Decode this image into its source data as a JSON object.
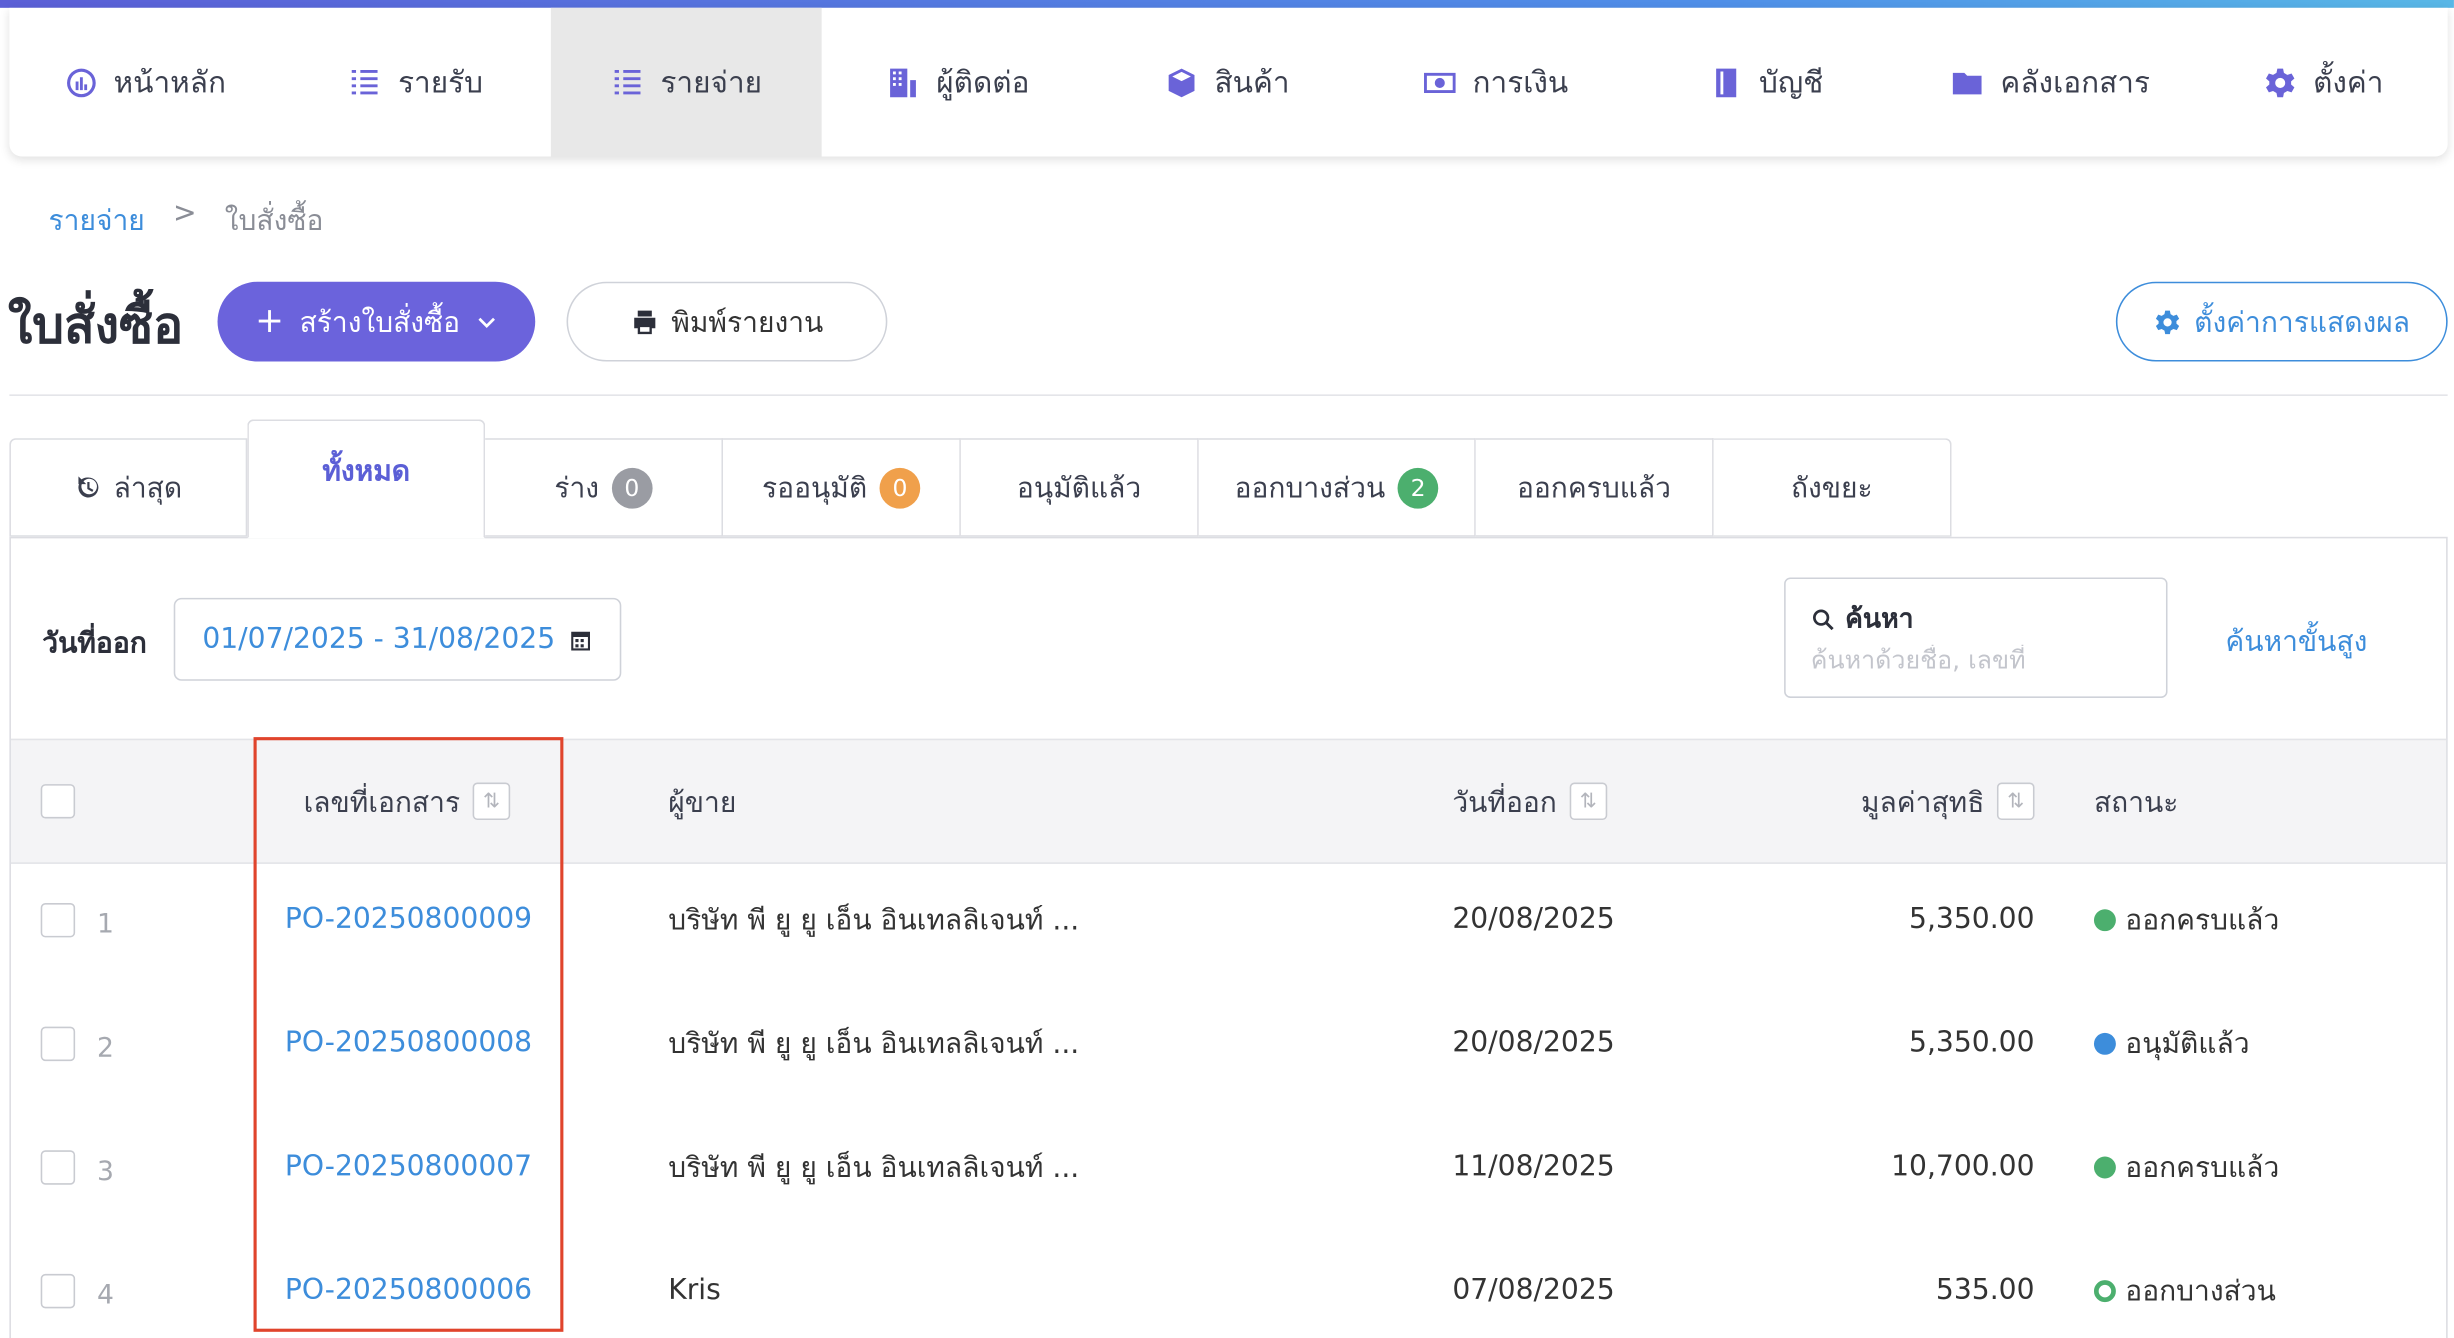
{
  "nav": {
    "items": [
      {
        "label": "หน้าหลัก",
        "icon": "dashboard-icon"
      },
      {
        "label": "รายรับ",
        "icon": "income-list-icon"
      },
      {
        "label": "รายจ่าย",
        "icon": "expense-list-icon",
        "active": true
      },
      {
        "label": "ผู้ติดต่อ",
        "icon": "contacts-building-icon"
      },
      {
        "label": "สินค้า",
        "icon": "product-box-icon"
      },
      {
        "label": "การเงิน",
        "icon": "money-icon"
      },
      {
        "label": "บัญชี",
        "icon": "ledger-book-icon"
      },
      {
        "label": "คลังเอกสาร",
        "icon": "folder-icon"
      },
      {
        "label": "ตั้งค่า",
        "icon": "gear-icon"
      }
    ]
  },
  "breadcrumb": {
    "parent": "รายจ่าย",
    "separator": ">",
    "current": "ใบสั่งซื้อ"
  },
  "header": {
    "title": "ใบสั่งซื้อ",
    "create_label": "สร้างใบสั่งซื้อ",
    "print_label": "พิมพ์รายงาน",
    "display_settings_label": "ตั้งค่าการแสดงผล"
  },
  "tabs": [
    {
      "label": "ล่าสุด",
      "icon": "history-icon"
    },
    {
      "label": "ทั้งหมด",
      "active": true
    },
    {
      "label": "ร่าง",
      "count": "0",
      "badge_color": "#9a9ca3"
    },
    {
      "label": "รออนุมัติ",
      "count": "0",
      "badge_color": "#f0a04b"
    },
    {
      "label": "อนุมัติแล้ว"
    },
    {
      "label": "ออกบางส่วน",
      "count": "2",
      "badge_color": "#4caf6e"
    },
    {
      "label": "ออกครบแล้ว"
    },
    {
      "label": "ถังขยะ"
    }
  ],
  "filters": {
    "date_label": "วันที่ออก",
    "date_range": "01/07/2025 - 31/08/2025",
    "search_label": "ค้นหา",
    "search_placeholder": "ค้นหาด้วยชื่อ, เลขที่",
    "search_value": "",
    "advanced_search_label": "ค้นหาขั้นสูง"
  },
  "table": {
    "columns": {
      "doc_no": "เลขที่เอกสาร",
      "vendor": "ผู้ขาย",
      "issue_date": "วันที่ออก",
      "net_value": "มูลค่าสุทธิ",
      "status": "สถานะ"
    },
    "rows": [
      {
        "num": "1",
        "doc_no": "PO-20250800009",
        "vendor": "บริษัท พี ยู ยู เอ็น อินเทลลิเจนท์ ...",
        "issue_date": "20/08/2025",
        "net_value": "5,350.00",
        "status": "ออกครบแล้ว",
        "status_color": "#4caf6e",
        "status_style": "filled"
      },
      {
        "num": "2",
        "doc_no": "PO-20250800008",
        "vendor": "บริษัท พี ยู ยู เอ็น อินเทลลิเจนท์ ...",
        "issue_date": "20/08/2025",
        "net_value": "5,350.00",
        "status": "อนุมัติแล้ว",
        "status_color": "#3d8ddb",
        "status_style": "filled"
      },
      {
        "num": "3",
        "doc_no": "PO-20250800007",
        "vendor": "บริษัท พี ยู ยู เอ็น อินเทลลิเจนท์ ...",
        "issue_date": "11/08/2025",
        "net_value": "10,700.00",
        "status": "ออกครบแล้ว",
        "status_color": "#4caf6e",
        "status_style": "filled"
      },
      {
        "num": "4",
        "doc_no": "PO-20250800006",
        "vendor": "Kris",
        "issue_date": "07/08/2025",
        "net_value": "535.00",
        "status": "ออกบางส่วน",
        "status_color": "#4caf6e",
        "status_style": "ring"
      }
    ]
  },
  "colors": {
    "accent": "#6b63dc",
    "link": "#3d8ddb",
    "highlight": "#e0442c"
  }
}
